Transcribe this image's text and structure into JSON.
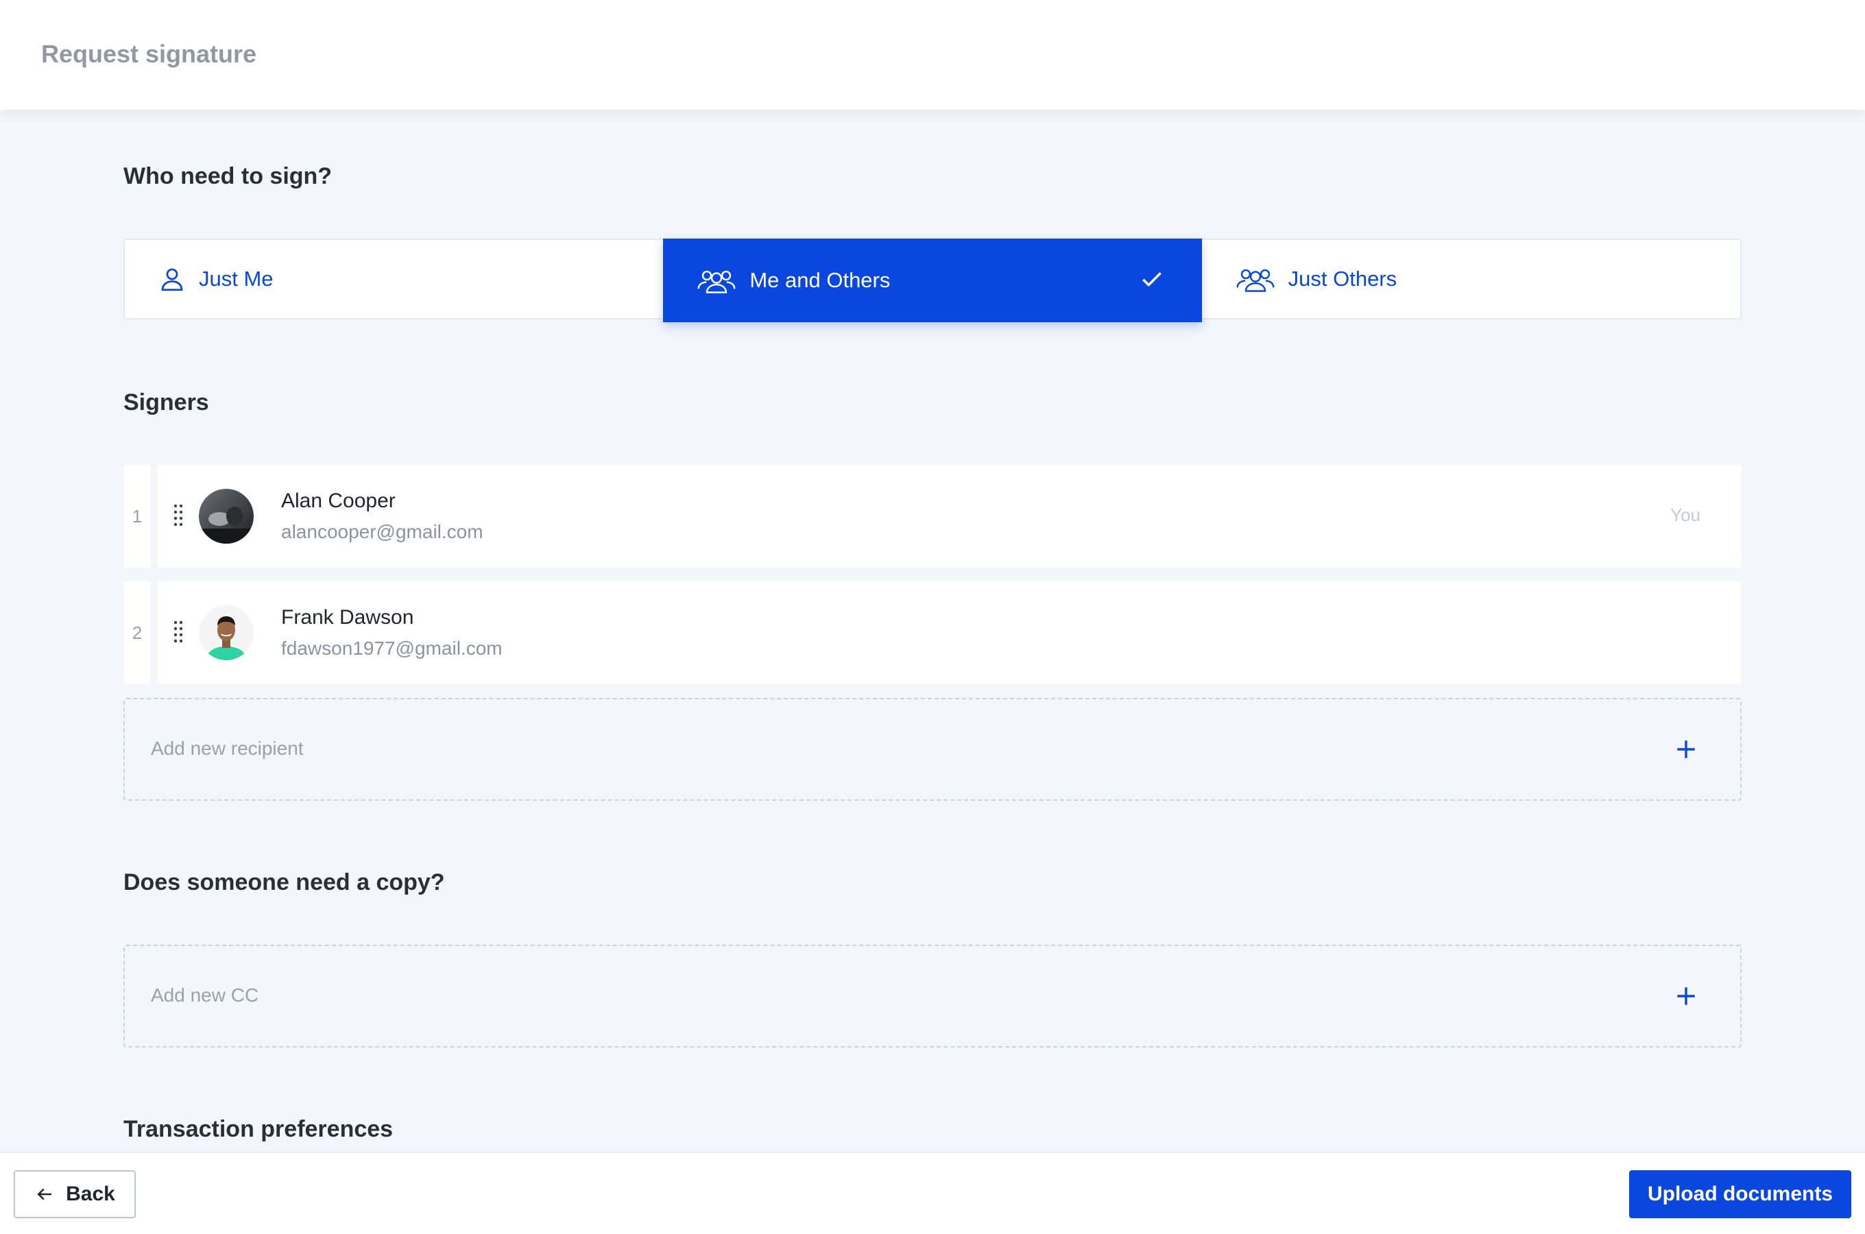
{
  "header": {
    "title": "Request signature"
  },
  "who_sign": {
    "heading": "Who need to sign?",
    "options": [
      {
        "label": "Just Me",
        "icon": "user-icon",
        "selected": false
      },
      {
        "label": "Me and Others",
        "icon": "users-icon",
        "selected": true
      },
      {
        "label": "Just Others",
        "icon": "users-group-icon",
        "selected": false
      }
    ]
  },
  "signers": {
    "heading": "Signers",
    "list": [
      {
        "order": "1",
        "name": "Alan Cooper",
        "email": "alancooper@gmail.com",
        "tag": "You",
        "avatar": "avatar-photo"
      },
      {
        "order": "2",
        "name": "Frank Dawson",
        "email": "fdawson1977@gmail.com",
        "tag": "",
        "avatar": "avatar-photo"
      }
    ],
    "add_placeholder": "Add new recipient"
  },
  "cc": {
    "heading": "Does someone need a copy?",
    "add_placeholder": "Add new CC"
  },
  "transaction": {
    "heading": "Transaction preferences"
  },
  "footer": {
    "back_label": "Back",
    "upload_label": "Upload documents"
  },
  "colors": {
    "accent": "#0a47de",
    "background": "#f3f6fb",
    "muted_text": "#8b939c"
  }
}
